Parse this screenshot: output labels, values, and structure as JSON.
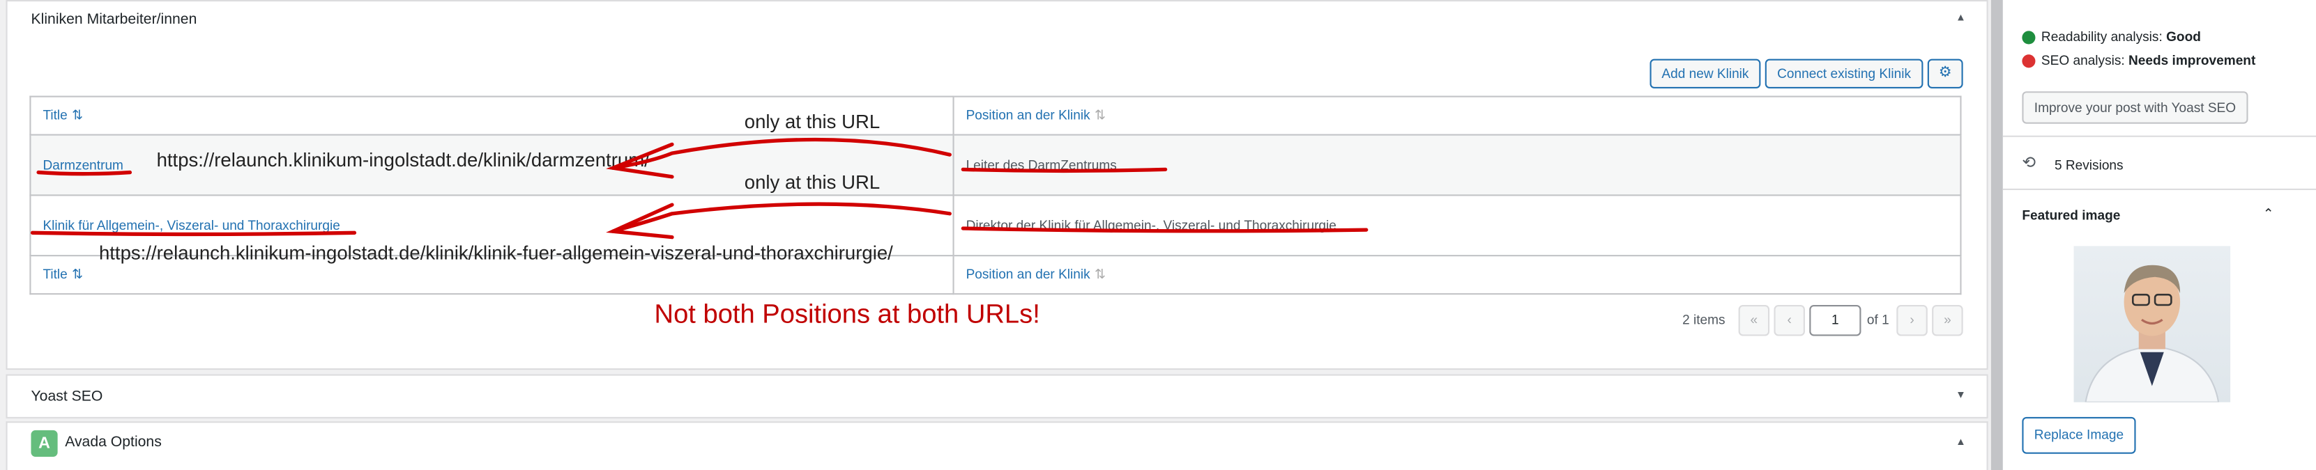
{
  "metabox_clinics": {
    "title": "Kliniken Mitarbeiter/innen",
    "add_new_label": "Add new Klinik",
    "connect_existing_label": "Connect existing Klinik",
    "columns": [
      "Title",
      "Position an der Klinik"
    ],
    "rows": [
      {
        "title": "Darmzentrum",
        "position": "Leiter des DarmZentrums"
      },
      {
        "title": "Klinik für Allgemein-, Viszeral- und Thoraxchirurgie",
        "position": "Direktor der Klinik für Allgemein-, Viszeral- und Thoraxchirurgie"
      }
    ],
    "items_count": "2 items",
    "page_current": "1",
    "page_total": "of 1"
  },
  "annotations": {
    "only_at_url_1": "only at this URL",
    "only_at_url_2": "only at this URL",
    "url_1": "https://relaunch.klinikum-ingolstadt.de/klinik/darmzentrum/",
    "url_2": "https://relaunch.klinikum-ingolstadt.de/klinik/klinik-fuer-allgemein-viszeral-und-thoraxchirurgie/",
    "warning": "Not both Positions at both URLs!",
    "ink_color": "#d10000"
  },
  "metabox_yoast": {
    "title": "Yoast SEO"
  },
  "metabox_avada": {
    "title": "Avada Options"
  },
  "sidebar": {
    "readability_label": "Readability analysis:",
    "readability_value": "Good",
    "seo_label": "SEO analysis:",
    "seo_value": "Needs improvement",
    "improve_button": "Improve your post with Yoast SEO",
    "revisions": "5 Revisions",
    "featured_image_title": "Featured image",
    "replace_image": "Replace Image",
    "good_color": "#1e8e3e",
    "bad_color": "#dc3232"
  }
}
